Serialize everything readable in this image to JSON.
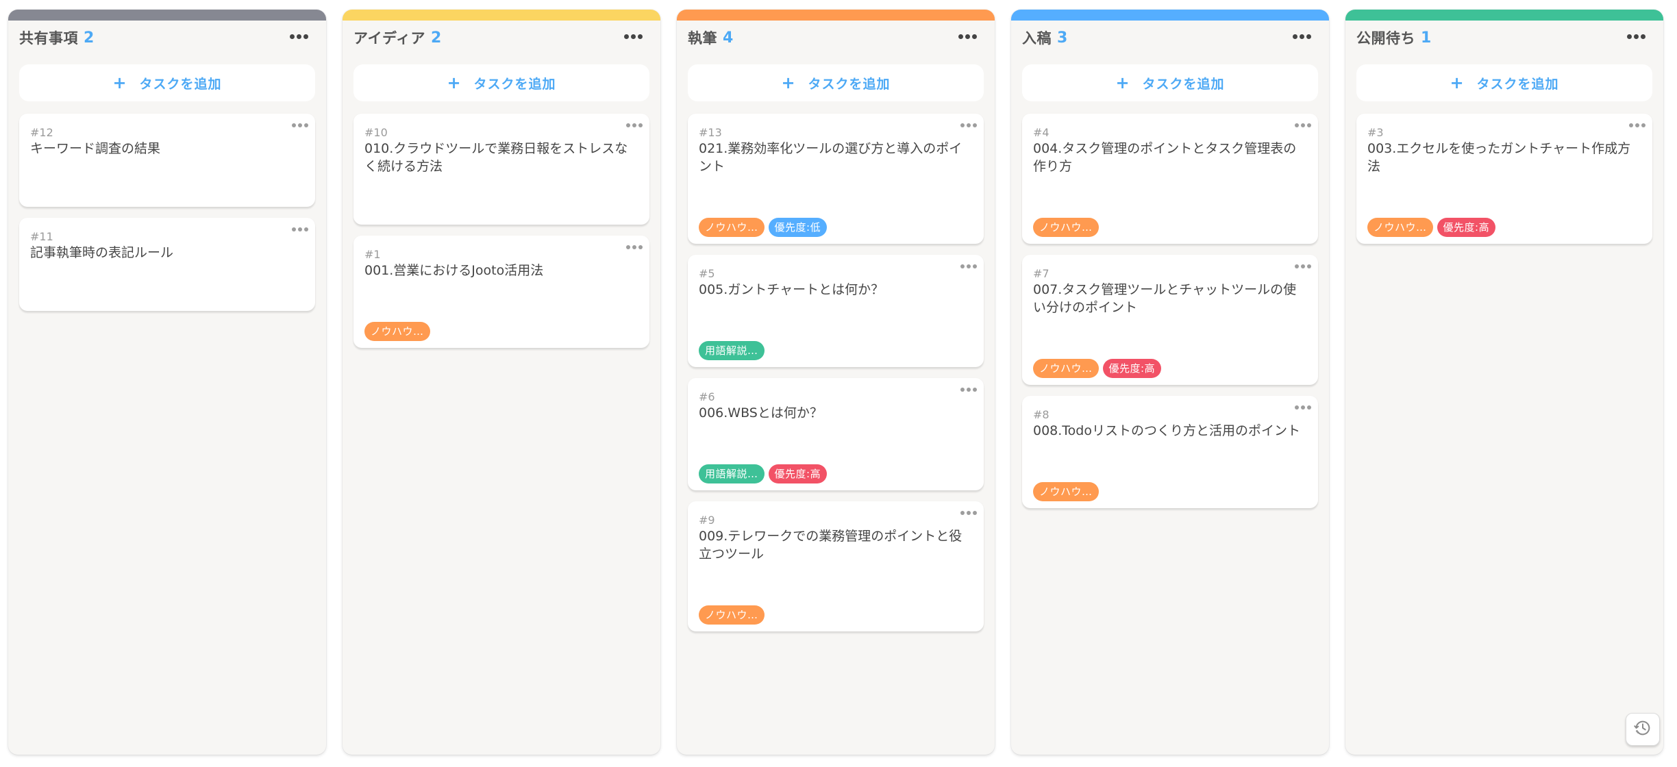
{
  "board": {
    "add_task_label": "タスクを追加",
    "add_task_icon": "plus-icon",
    "columns": [
      {
        "title": "共有事項",
        "count": "2",
        "color": "#868892",
        "cards": [
          {
            "id": "#12",
            "title": "キーワード調査の結果",
            "tags": []
          },
          {
            "id": "#11",
            "title": "記事執筆時の表記ルール",
            "tags": []
          }
        ]
      },
      {
        "title": "アイディア",
        "count": "2",
        "color": "#fbd561",
        "cards": [
          {
            "id": "#10",
            "title": "010.クラウドツールで業務日報をストレスなく続ける方法",
            "tags": []
          },
          {
            "id": "#1",
            "title": "001.営業におけるJooto活用法",
            "tags": [
              {
                "label": "ノウハウ…",
                "color": "#ff9a50"
              }
            ]
          }
        ]
      },
      {
        "title": "執筆",
        "count": "4",
        "color": "#ff9a50",
        "cards": [
          {
            "id": "#13",
            "title": "021.業務効率化ツールの選び方と導入のポイント",
            "tags": [
              {
                "label": "ノウハウ…",
                "color": "#ff9a50"
              },
              {
                "label": "優先度:低",
                "color": "#55aeff"
              }
            ]
          },
          {
            "id": "#5",
            "title": "005.ガントチャートとは何か？",
            "tags": [
              {
                "label": "用語解説…",
                "color": "#3ec197"
              }
            ]
          },
          {
            "id": "#6",
            "title": "006.WBSとは何か？",
            "tags": [
              {
                "label": "用語解説…",
                "color": "#3ec197"
              },
              {
                "label": "優先度:高",
                "color": "#f25266"
              }
            ]
          },
          {
            "id": "#9",
            "title": "009.テレワークでの業務管理のポイントと役立つツール",
            "tags": [
              {
                "label": "ノウハウ…",
                "color": "#ff9a50"
              }
            ]
          }
        ]
      },
      {
        "title": "入稿",
        "count": "3",
        "color": "#55aeff",
        "cards": [
          {
            "id": "#4",
            "title": "004.タスク管理のポイントとタスク管理表の作り方",
            "tags": [
              {
                "label": "ノウハウ…",
                "color": "#ff9a50"
              }
            ]
          },
          {
            "id": "#7",
            "title": "007.タスク管理ツールとチャットツールの使い分けのポイント",
            "tags": [
              {
                "label": "ノウハウ…",
                "color": "#ff9a50"
              },
              {
                "label": "優先度:高",
                "color": "#f25266"
              }
            ]
          },
          {
            "id": "#8",
            "title": "008.Todoリストのつくり方と活用のポイント",
            "tags": [
              {
                "label": "ノウハウ…",
                "color": "#ff9a50"
              }
            ]
          }
        ]
      },
      {
        "title": "公開待ち",
        "count": "1",
        "color": "#3ec197",
        "cards": [
          {
            "id": "#3",
            "title": "003.エクセルを使ったガントチャート作成方法",
            "tags": [
              {
                "label": "ノウハウ…",
                "color": "#ff9a50"
              },
              {
                "label": "優先度:高",
                "color": "#f25266"
              }
            ]
          }
        ]
      }
    ]
  },
  "theme": {
    "count_color": "#4da9f5",
    "accent": "#4da9f5"
  },
  "history_button": {
    "icon": "history-icon"
  }
}
